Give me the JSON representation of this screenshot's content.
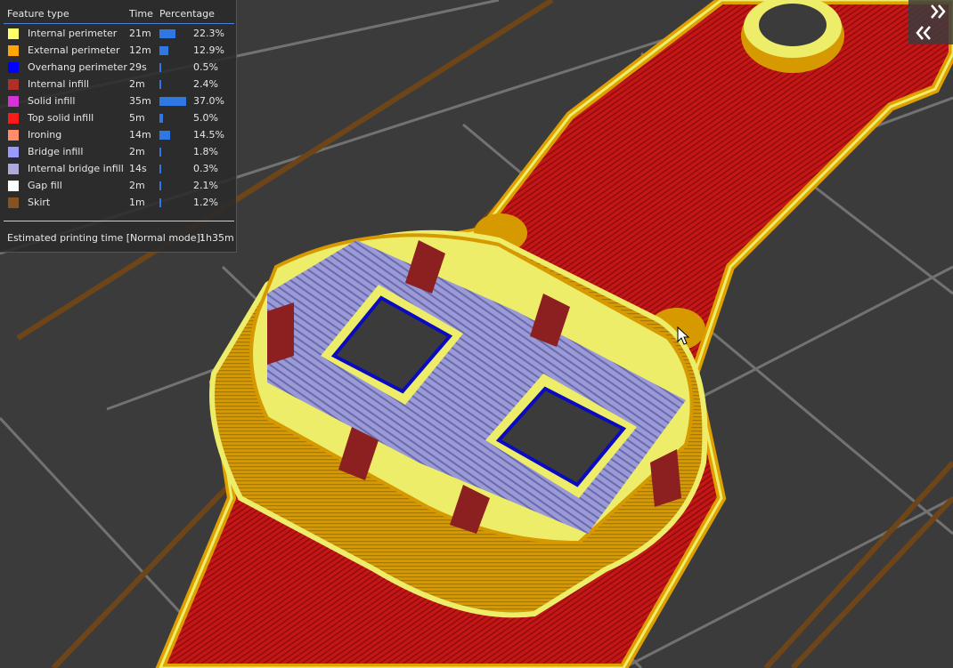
{
  "legend": {
    "headers": {
      "feature": "Feature type",
      "time": "Time",
      "percentage": "Percentage"
    },
    "rows": [
      {
        "label": "Internal perimeter",
        "time": "21m",
        "pct": "22.3%",
        "fraction": 0.223,
        "color": "#ffff68"
      },
      {
        "label": "External perimeter",
        "time": "12m",
        "pct": "12.9%",
        "fraction": 0.129,
        "color": "#ffa500"
      },
      {
        "label": "Overhang perimeter",
        "time": "29s",
        "pct": "0.5%",
        "fraction": 0.005,
        "color": "#0000ff"
      },
      {
        "label": "Internal infill",
        "time": "2m",
        "pct": "2.4%",
        "fraction": 0.024,
        "color": "#b03029"
      },
      {
        "label": "Solid infill",
        "time": "35m",
        "pct": "37.0%",
        "fraction": 0.37,
        "color": "#d732d7"
      },
      {
        "label": "Top solid infill",
        "time": "5m",
        "pct": "5.0%",
        "fraction": 0.05,
        "color": "#ff1a1a"
      },
      {
        "label": "Ironing",
        "time": "14m",
        "pct": "14.5%",
        "fraction": 0.145,
        "color": "#ff8c69"
      },
      {
        "label": "Bridge infill",
        "time": "2m",
        "pct": "1.8%",
        "fraction": 0.018,
        "color": "#9999ff"
      },
      {
        "label": "Internal bridge infill",
        "time": "14s",
        "pct": "0.3%",
        "fraction": 0.003,
        "color": "#aaaadd"
      },
      {
        "label": "Gap fill",
        "time": "2m",
        "pct": "2.1%",
        "fraction": 0.021,
        "color": "#ffffff"
      },
      {
        "label": "Skirt",
        "time": "1m",
        "pct": "1.2%",
        "fraction": 0.012,
        "color": "#845321"
      }
    ],
    "estimate_label": "Estimated printing time [Normal mode]:",
    "estimate_value": "1h35m"
  },
  "sidebar_toggle": {
    "icon": "double-chevron-collapse-icon"
  },
  "colors": {
    "bed": "#3b3b3b",
    "grid": "#7a7a7a",
    "bar": "#2f78e4"
  }
}
